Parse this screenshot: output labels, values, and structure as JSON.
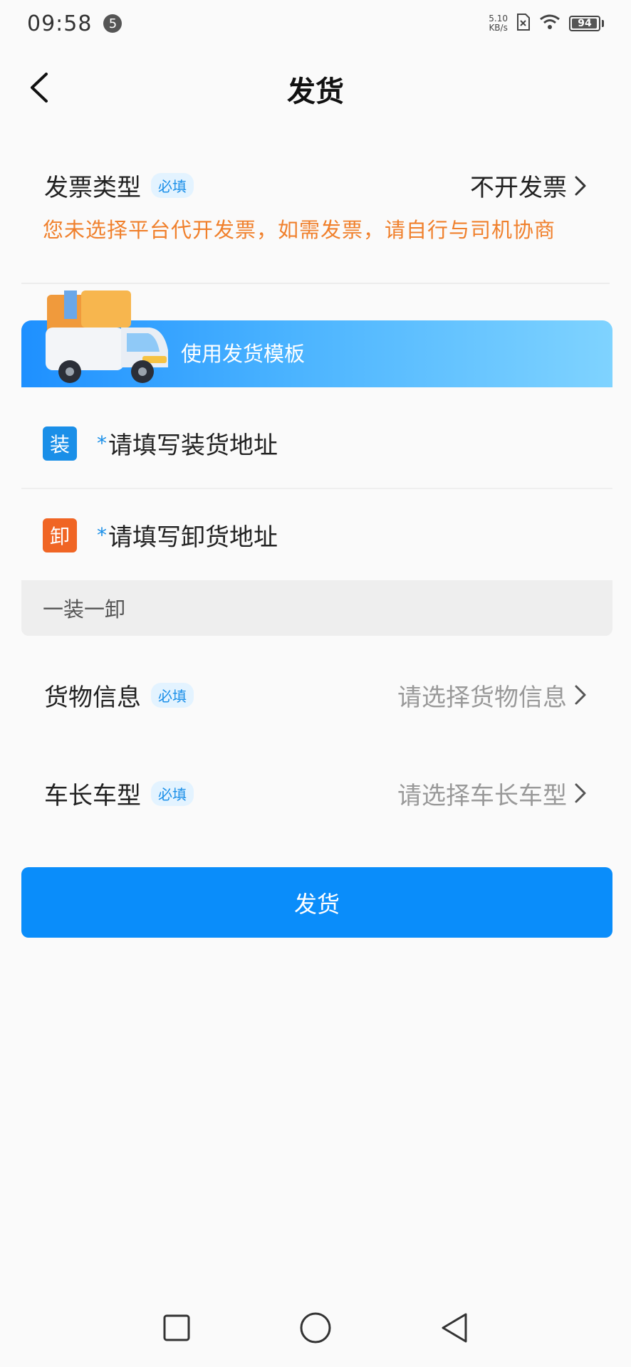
{
  "status_bar": {
    "time": "09:58",
    "notification_count": "5",
    "net_speed_value": "5.10",
    "net_speed_unit": "KB/s",
    "battery_level": "94"
  },
  "header": {
    "title": "发货"
  },
  "invoice": {
    "label": "发票类型",
    "required": "必填",
    "value": "不开发票",
    "warning": "您未选择平台代开发票，如需发票，请自行与司机协商"
  },
  "template_banner": {
    "label": "使用发货模板"
  },
  "addresses": {
    "load_tag": "装",
    "load_star": "*",
    "load_placeholder": "请填写装货地址",
    "unload_tag": "卸",
    "unload_star": "*",
    "unload_placeholder": "请填写卸货地址"
  },
  "mode": {
    "label": "一装一卸"
  },
  "cargo": {
    "label": "货物信息",
    "required": "必填",
    "placeholder": "请选择货物信息"
  },
  "vehicle": {
    "label": "车长车型",
    "required": "必填",
    "placeholder": "请选择车长车型"
  },
  "submit": {
    "label": "发货"
  },
  "colors": {
    "primary": "#0a8dfa",
    "warning": "#f0802c",
    "load_tag": "#1a8fe8",
    "unload_tag": "#f06524"
  }
}
